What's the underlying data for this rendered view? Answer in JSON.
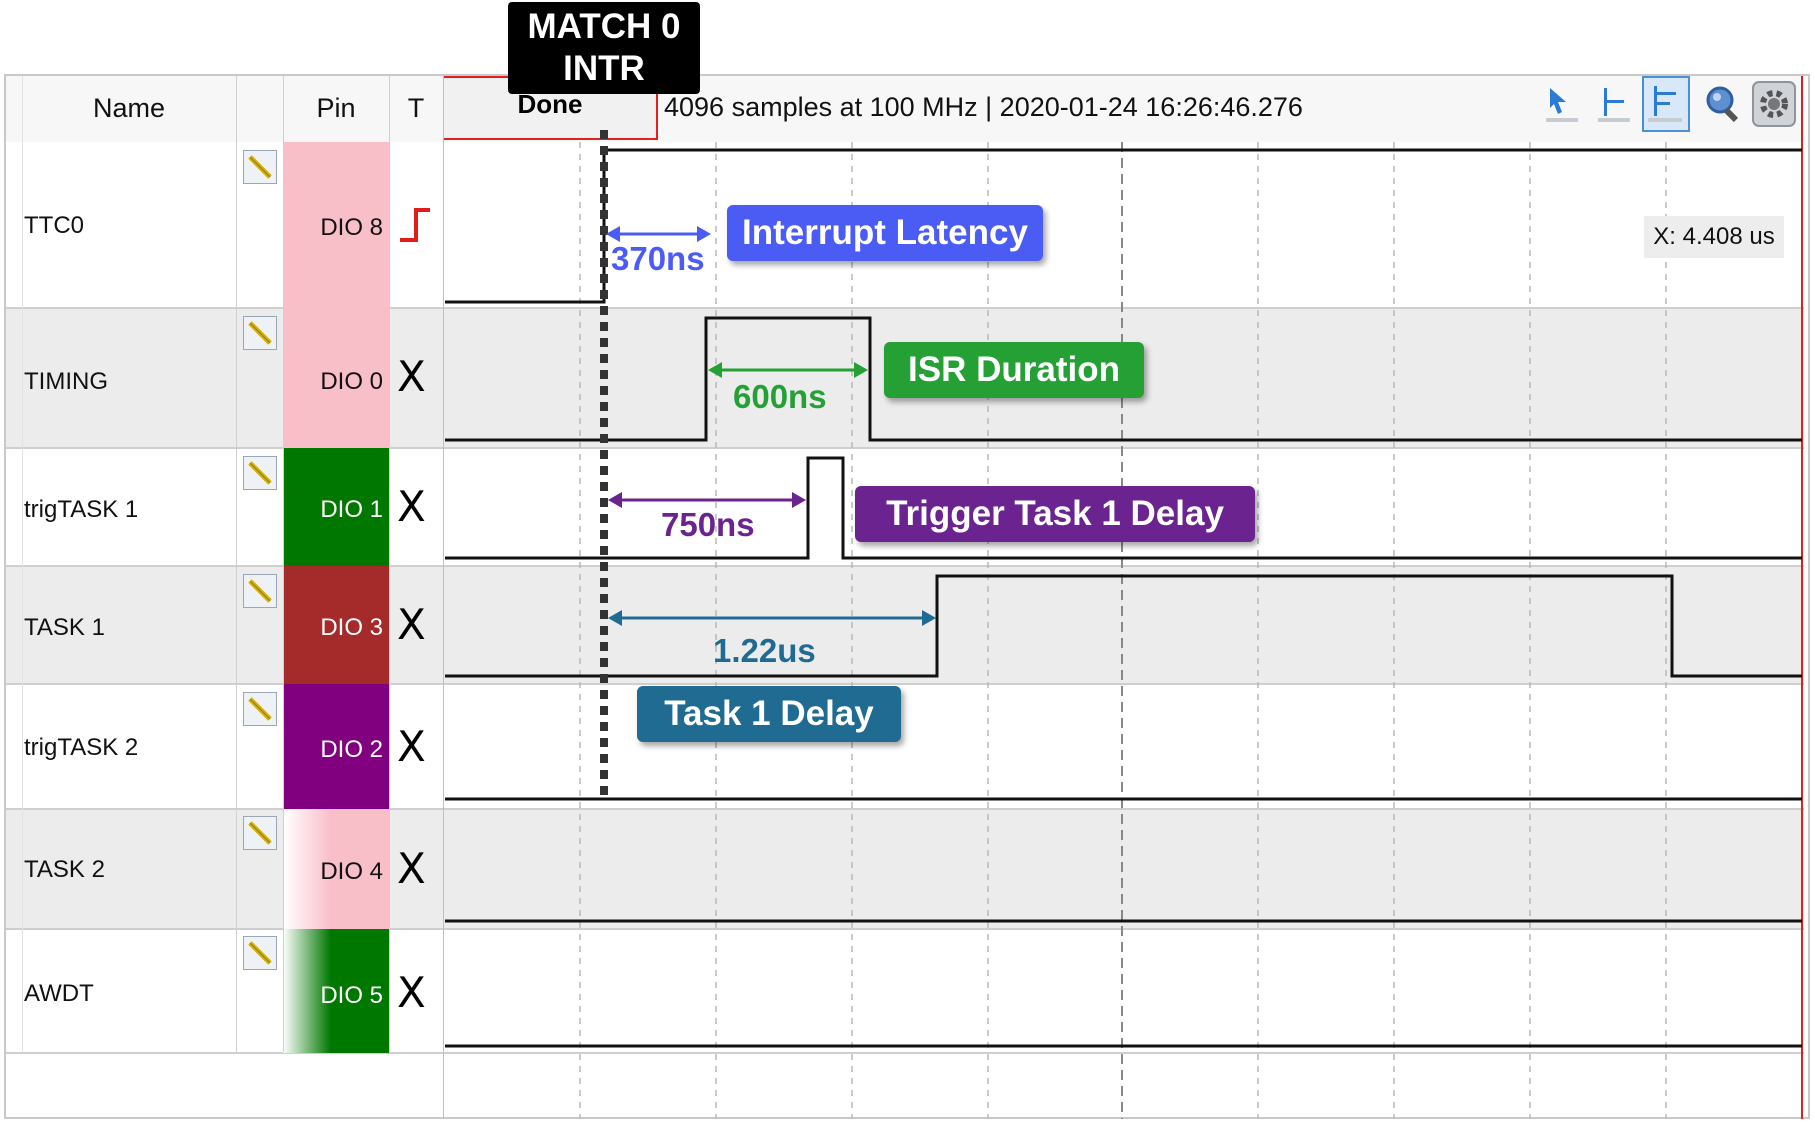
{
  "header": {
    "col_name": "Name",
    "col_pin": "Pin",
    "col_trigger": "T",
    "status": "Done",
    "info": "4096 samples at 100 MHz | 2020-01-24 16:26:46.276"
  },
  "marker": {
    "line1": "MATCH 0",
    "line2": "INTR"
  },
  "cursor_readout": "X: 4.408 us",
  "toolbar": {
    "icons": [
      "cursor-arrow-icon",
      "marker-icon",
      "marker-active-icon",
      "zoom-icon",
      "settings-gear-icon"
    ]
  },
  "signals": [
    {
      "name": "TTC0",
      "pin": "DIO  8",
      "trigger": "rising-edge",
      "pin_color": "#f8bfc9"
    },
    {
      "name": "TIMING",
      "pin": "DIO  0",
      "trigger": "X",
      "pin_color": "#f8bfc9"
    },
    {
      "name": "trigTASK 1",
      "pin": "DIO  1",
      "trigger": "X",
      "pin_color": "#007800"
    },
    {
      "name": "TASK 1",
      "pin": "DIO  3",
      "trigger": "X",
      "pin_color": "#a52a2a"
    },
    {
      "name": "trigTASK 2",
      "pin": "DIO  2",
      "trigger": "X",
      "pin_color": "#800080"
    },
    {
      "name": "TASK 2",
      "pin": "DIO  4",
      "trigger": "X",
      "pin_color": "#f8bfc9"
    },
    {
      "name": "AWDT",
      "pin": "DIO  5",
      "trigger": "X",
      "pin_color": "#007800"
    }
  ],
  "annotations": {
    "interrupt_latency": {
      "label": "Interrupt Latency",
      "value": "370ns",
      "color": "#4b5cf5"
    },
    "isr_duration": {
      "label": "ISR Duration",
      "value": "600ns",
      "color": "#24a035"
    },
    "trigger_task1_delay": {
      "label": "Trigger Task 1 Delay",
      "value": "750ns",
      "color": "#6a238f"
    },
    "task1_delay": {
      "label": "Task 1 Delay",
      "value": "1.22us",
      "color": "#1f6b91"
    }
  },
  "colors": {
    "marker_line": "#333333",
    "trigger_edge": "#e31b1b",
    "done_border": "#e02020"
  }
}
